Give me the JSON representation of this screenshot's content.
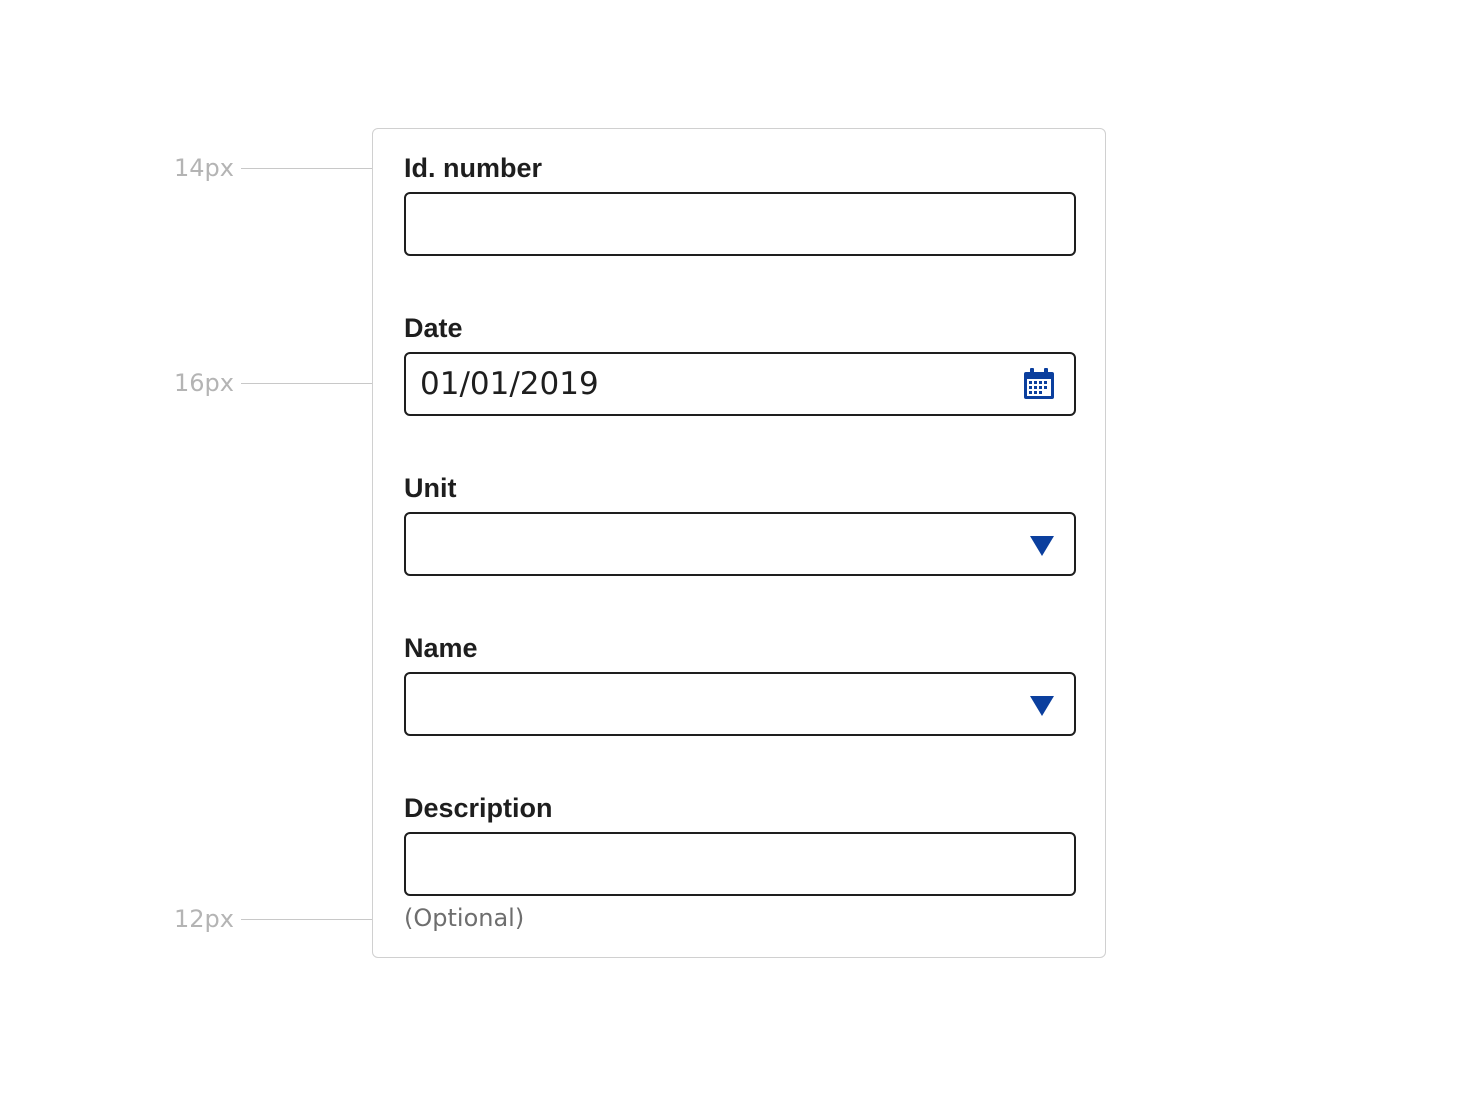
{
  "annotations": {
    "label_size": "14px",
    "input_size": "16px",
    "hint_size": "12px"
  },
  "form": {
    "id_number": {
      "label": "Id. number",
      "value": ""
    },
    "date": {
      "label": "Date",
      "value": "01/01/2019",
      "icon": "calendar-icon"
    },
    "unit": {
      "label": "Unit",
      "value": "",
      "icon": "chevron-down-icon"
    },
    "name": {
      "label": "Name",
      "value": "",
      "icon": "chevron-down-icon"
    },
    "description": {
      "label": "Description",
      "value": "",
      "hint": "(Optional)"
    }
  },
  "colors": {
    "accent": "#0b3f9e",
    "text": "#1e1e1e",
    "annotation": "#b4b4b4",
    "border": "#1e1e1e"
  }
}
